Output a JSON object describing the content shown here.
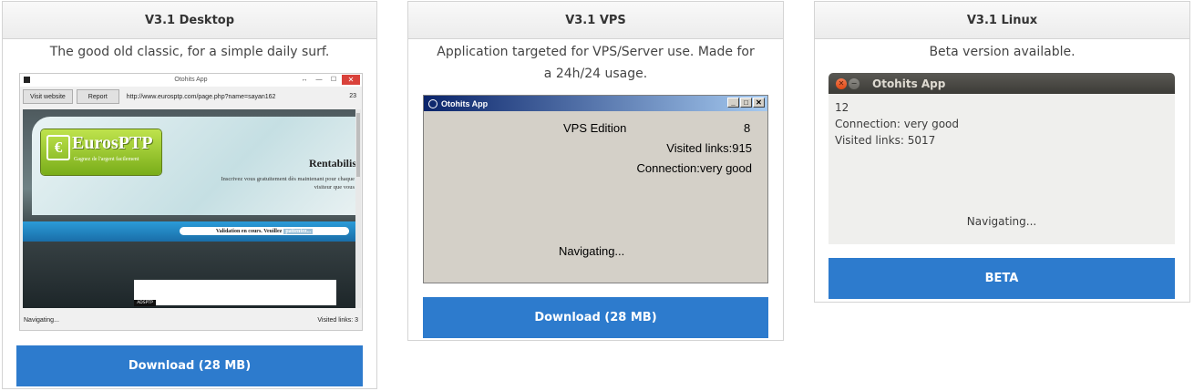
{
  "cards": [
    {
      "header": "V3.1 Desktop",
      "description": "The good old classic, for a simple daily surf.",
      "button": "Download (28 MB)",
      "screenshot": {
        "title": "Otohits App",
        "close_glyph": "✕",
        "max_glyph": "☐",
        "min_glyph": "—",
        "resize_glyph": "↔",
        "visit_button": "Visit website",
        "report_button": "Report",
        "url": "http://www.eurosptp.com/page.php?name=sayan162",
        "counter": "23",
        "site": {
          "brand": "EurosPTP",
          "tagline": "Gagnez de l'argent facilement",
          "heading": "Rentabilis",
          "text": "Inscrivez vous gratuitement dès maintenant pour chaque visiteur que vous",
          "validation": "Validation en cours. Veuillez",
          "patientez": "patientez...",
          "ad_label": "ADSPTP"
        },
        "status_left": "Navigating...",
        "status_right": "Visited links: 3"
      }
    },
    {
      "header": "V3.1 VPS",
      "description": "Application targeted for VPS/Server use. Made for a 24h/24 usage.",
      "button": "Download (28 MB)",
      "screenshot": {
        "title": "Otohits App",
        "edition": "VPS Edition",
        "counter": "8",
        "visited": "Visited links:915",
        "connection": "Connection:very good",
        "status": "Navigating..."
      }
    },
    {
      "header": "V3.1 Linux",
      "description": "Beta version available.",
      "button": "BETA",
      "screenshot": {
        "title": "Otohits App",
        "counter": "12",
        "connection": "Connection: very good",
        "visited": "Visited links: 5017",
        "status": "Navigating..."
      }
    }
  ],
  "colors": {
    "button_blue": "#2d7bcd",
    "header_bg": "#f2f2f2",
    "border": "#d4d4d4"
  }
}
